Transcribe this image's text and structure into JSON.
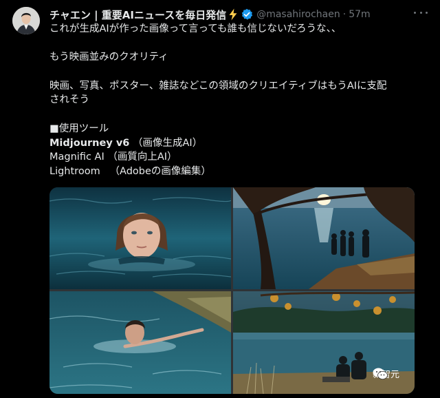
{
  "tweet": {
    "author_name": "チャエン | 重要AIニュースを毎日発信",
    "handle": "@masahirochaen",
    "separator": "·",
    "time": "57m",
    "lines": [
      "これが生成AIが作った画像って言っても誰も信じないだろうな、、",
      "もう映画並みのクオリティ",
      "映画、写真、ポスター、雑誌などこの領域のクリエイティブはもうAIに支配",
      "されそう",
      "■使用ツール"
    ],
    "tools": [
      {
        "name": "Midjourney v6",
        "note": "（画像生成AI）"
      },
      {
        "name": "Magnific AI",
        "note": "（画質向上AI）"
      },
      {
        "name": "Lightroom",
        "note": "（Adobeの画像編集）"
      }
    ]
  },
  "images": [
    {
      "icon": "girl-swimming-photo"
    },
    {
      "icon": "lakeside-people-photo"
    },
    {
      "icon": "man-swimming-photo"
    },
    {
      "icon": "couple-sitting-by-lake-photo"
    }
  ],
  "watermark": {
    "label": "新智元"
  },
  "colors": {
    "background": "#000000",
    "text": "#e7e9ea",
    "muted": "#71767b",
    "verified": "#1d9bf0"
  }
}
